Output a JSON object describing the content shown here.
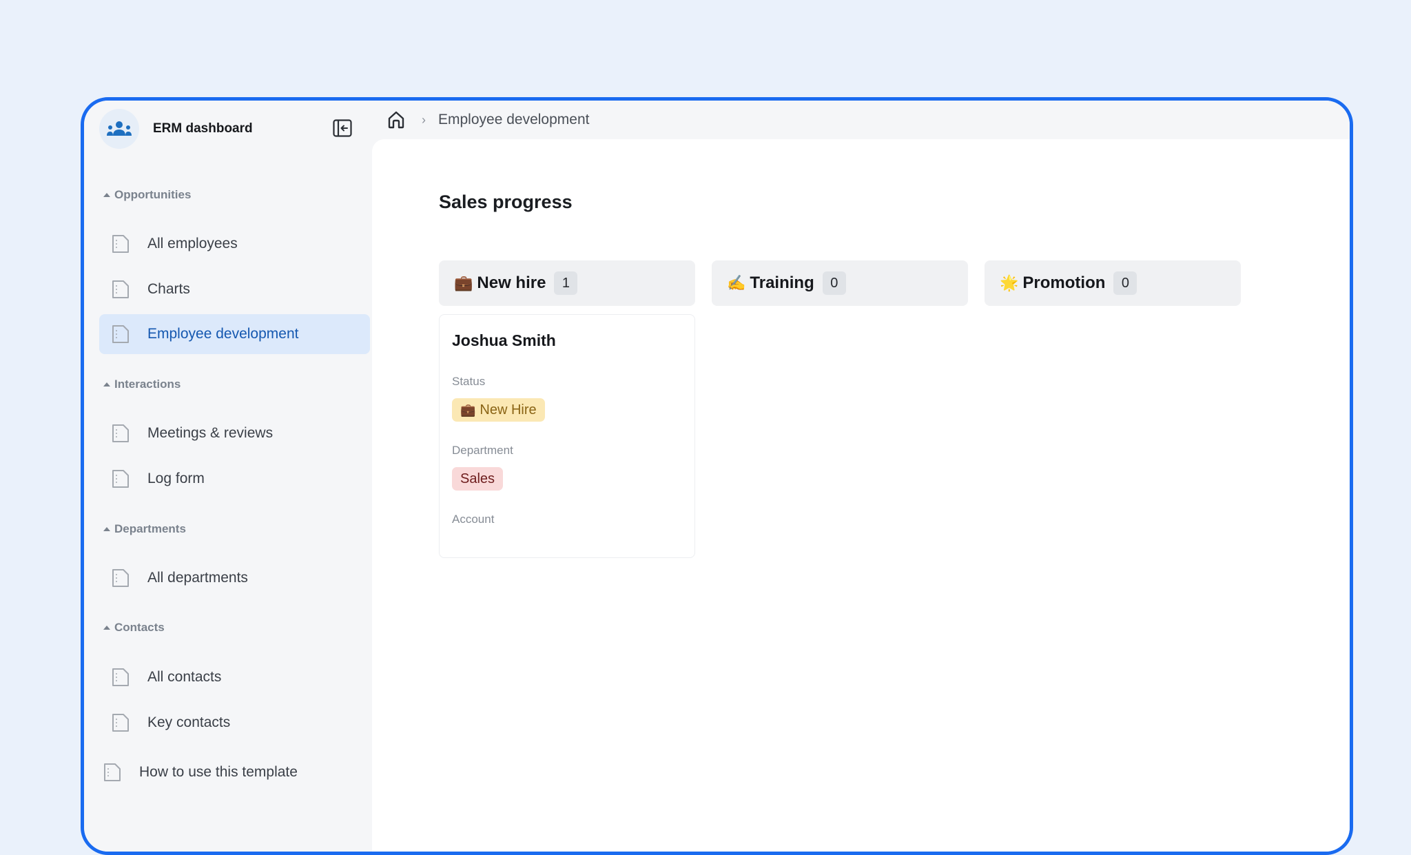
{
  "app": {
    "title": "ERM dashboard",
    "logo_icon": "users-group-icon",
    "collapse_icon": "sidebar-collapse-icon"
  },
  "sidebar": {
    "sections": [
      {
        "title": "Opportunities",
        "items": [
          {
            "label": "All employees",
            "icon": "page-icon",
            "active": false
          },
          {
            "label": "Charts",
            "icon": "page-icon",
            "active": false
          },
          {
            "label": "Employee development",
            "icon": "page-icon",
            "active": true
          }
        ]
      },
      {
        "title": "Interactions",
        "items": [
          {
            "label": "Meetings & reviews",
            "icon": "page-icon",
            "active": false
          },
          {
            "label": "Log form",
            "icon": "page-icon",
            "active": false
          }
        ]
      },
      {
        "title": "Departments",
        "items": [
          {
            "label": "All departments",
            "icon": "page-icon",
            "active": false
          }
        ]
      },
      {
        "title": "Contacts",
        "items": [
          {
            "label": "All contacts",
            "icon": "page-icon",
            "active": false
          },
          {
            "label": "Key contacts",
            "icon": "page-icon",
            "active": false
          }
        ]
      }
    ],
    "footer_item": {
      "label": "How to use this template",
      "icon": "page-icon"
    }
  },
  "breadcrumb": {
    "home_icon": "home-icon",
    "separator": "›",
    "current": "Employee development"
  },
  "main": {
    "title": "Sales progress",
    "columns": [
      {
        "emoji": "💼",
        "label": "New hire",
        "count": "1"
      },
      {
        "emoji": "✍️",
        "label": "Training",
        "count": "0"
      },
      {
        "emoji": "🌟",
        "label": "Promotion",
        "count": "0"
      }
    ],
    "cards": [
      {
        "name": "Joshua Smith",
        "status_label": "Status",
        "status_emoji": "💼",
        "status_value": "New Hire",
        "department_label": "Department",
        "department_value": "Sales",
        "account_label": "Account"
      }
    ]
  },
  "colors": {
    "frame_border": "#1a6bf0",
    "background": "#eaf1fb",
    "active_nav_bg": "#dce9fb",
    "active_nav_text": "#1558b0",
    "status_tag_bg": "#fbe8b4",
    "department_tag_bg": "#f9d9d9"
  }
}
